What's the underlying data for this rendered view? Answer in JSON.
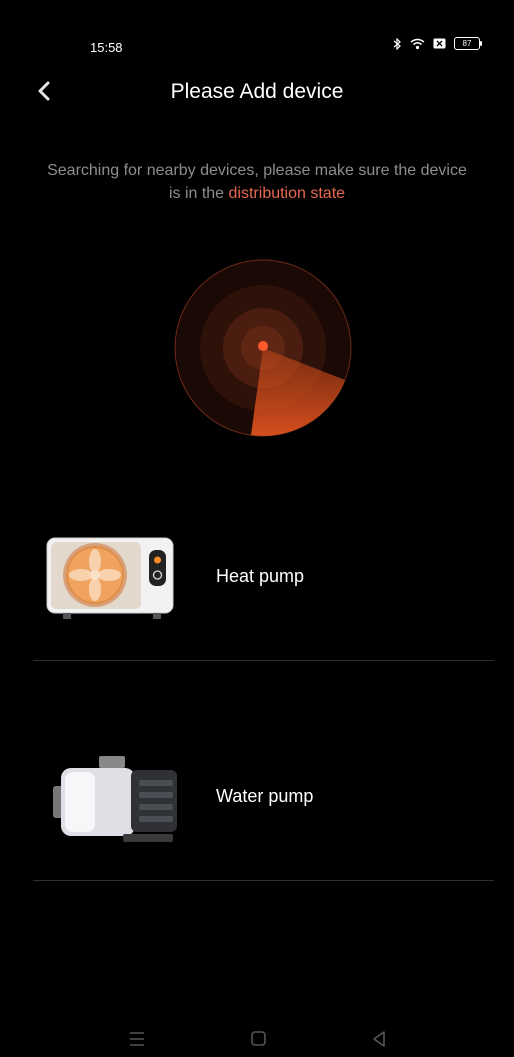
{
  "status": {
    "time": "15:58",
    "battery": "87",
    "icons": [
      "bluetooth-icon",
      "wifi-icon",
      "sim-icon",
      "battery-icon"
    ]
  },
  "header": {
    "title": "Please Add device",
    "back_icon": "chevron-left-icon"
  },
  "hint": {
    "line1": "Searching for nearby devices, please make sure the device",
    "line2_prefix": "is in the",
    "line2_accent": "distribution state"
  },
  "colors": {
    "accent": "#e8684f",
    "radar": "#d2501f",
    "background": "#000000",
    "divider": "#2e2e2e"
  },
  "devices": [
    {
      "name": "Heat pump",
      "icon": "heat-pump-icon"
    },
    {
      "name": "Water pump",
      "icon": "water-pump-icon"
    }
  ],
  "navbar": {
    "icons": [
      "menu-icon",
      "home-icon",
      "back-triangle-icon"
    ]
  }
}
